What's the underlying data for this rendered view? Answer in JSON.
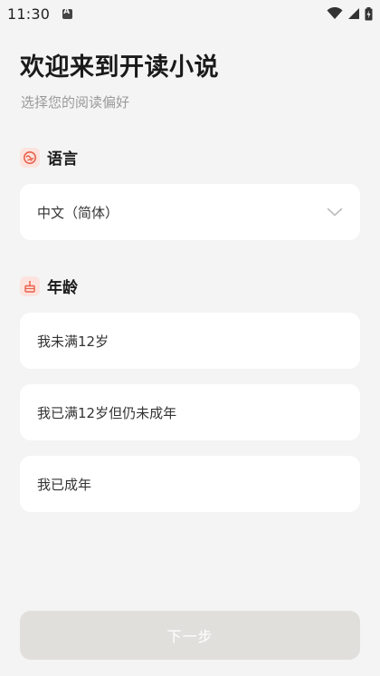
{
  "status_bar": {
    "time": "11:30",
    "icons": [
      "notification-icon",
      "wifi-icon",
      "signal-icon",
      "battery-icon"
    ]
  },
  "header": {
    "title": "欢迎来到开读小说",
    "subtitle": "选择您的阅读偏好"
  },
  "language": {
    "label": "语言",
    "icon": "language-icon",
    "selected": "中文（简体）"
  },
  "age": {
    "label": "年龄",
    "icon": "cake-icon",
    "options": [
      "我未满12岁",
      "我已满12岁但仍未成年",
      "我已成年"
    ]
  },
  "footer": {
    "next_label": "下一步"
  },
  "colors": {
    "background": "#f4f4f4",
    "card": "#ffffff",
    "accent": "#e8604a",
    "icon_bg": "#fde3de",
    "button_disabled": "#e0dfdc"
  }
}
